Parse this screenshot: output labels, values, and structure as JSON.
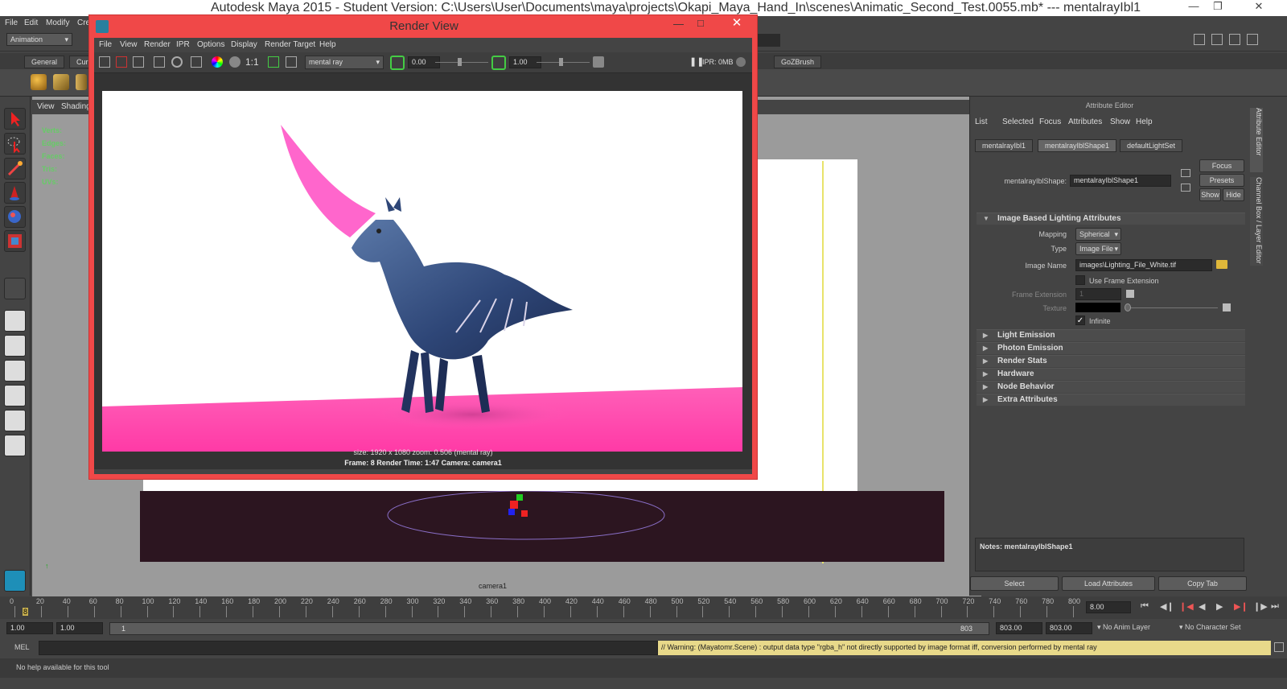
{
  "window": {
    "title": "Autodesk Maya 2015 - Student Version: C:\\Users\\User\\Documents\\maya\\projects\\Okapi_Maya_Hand_In\\scenes\\Animatic_Second_Test.0055.mb*   ---   mentalrayIbl1"
  },
  "menubar": {
    "items": [
      "File",
      "Edit",
      "Modify",
      "Cre"
    ]
  },
  "status_line": {
    "mode": "Animation"
  },
  "shelf": {
    "tabs": [
      "General",
      "Cur",
      "GoZBrush"
    ]
  },
  "viewport": {
    "menu": [
      "View",
      "Shading"
    ],
    "hud": [
      "Verts:",
      "Edges:",
      "Faces:",
      "Tris:",
      "UVs:"
    ],
    "camera_label": "camera1"
  },
  "render_view": {
    "title": "Render View",
    "menu": [
      "File",
      "View",
      "Render",
      "IPR",
      "Options",
      "Display",
      "Render Target",
      "Help"
    ],
    "ratio_label": "1:1",
    "renderer": "mental ray",
    "exposure": "0.00",
    "gamma": "1.00",
    "ipr_label": "IPR: 0MB",
    "info_size": "size: 1920 x 1080  zoom: 0.506       (mental ray)",
    "info_frame": "Frame: 8      Render Time: 1:47      Camera: camera1"
  },
  "attribute_editor": {
    "title": "Attribute Editor",
    "menu": [
      "List",
      "Selected",
      "Focus",
      "Attributes",
      "Show",
      "Help"
    ],
    "tabs": [
      "mentalrayIbl1",
      "mentalrayIblShape1",
      "defaultLightSet"
    ],
    "node_label": "mentalrayIblShape:",
    "node_value": "mentalrayIblShape1",
    "btn_focus": "Focus",
    "btn_presets": "Presets",
    "btn_show": "Show",
    "btn_hide": "Hide",
    "section_ibl": "Image Based Lighting Attributes",
    "mapping_label": "Mapping",
    "mapping_value": "Spherical",
    "type_label": "Type",
    "type_value": "Image File",
    "image_name_label": "Image Name",
    "image_name_value": "images\\Lighting_File_White.tif",
    "use_frame_ext": "Use Frame Extension",
    "frame_ext_label": "Frame Extension",
    "frame_ext_value": "1",
    "texture_label": "Texture",
    "infinite_label": "Infinite",
    "sections": [
      "Light Emission",
      "Photon Emission",
      "Render Stats",
      "Hardware",
      "Node Behavior",
      "Extra Attributes"
    ],
    "notes": "Notes:  mentalrayIblShape1",
    "btn_select": "Select",
    "btn_load": "Load Attributes",
    "btn_copy": "Copy Tab"
  },
  "side_tabs": [
    "Attribute Editor",
    "Channel Box / Layer Editor"
  ],
  "timeline": {
    "ticks": [
      "0",
      "20",
      "40",
      "60",
      "80",
      "100",
      "120",
      "140",
      "160",
      "180",
      "200",
      "220",
      "240",
      "260",
      "280",
      "300",
      "320",
      "340",
      "360",
      "380",
      "400",
      "420",
      "440",
      "460",
      "480",
      "500",
      "520",
      "540",
      "560",
      "580",
      "600",
      "620",
      "640",
      "660",
      "680",
      "700",
      "720",
      "740",
      "760",
      "780",
      "800"
    ],
    "current_frame_marker": "8",
    "current_frame": "8.00"
  },
  "range": {
    "start": "1.00",
    "start2": "1.00",
    "slider_start": "1",
    "slider_end": "803",
    "end": "803.00",
    "end2": "803.00",
    "anim_layer": "No Anim Layer",
    "character_set": "No Character Set"
  },
  "command_line": {
    "label": "MEL",
    "warning": "// Warning: (Mayatomr.Scene) : output data type \"rgba_h\" not directly supported by image format iff, conversion performed by mental ray"
  },
  "help_line": {
    "text": "No help available for this tool"
  },
  "colors": {
    "accent_red": "#f04848",
    "horn_pink": "#ff66cc",
    "floor_pink": "#ff5fb8",
    "creature_blue": "#2e4677",
    "warning_yellow": "#e8d98a"
  }
}
